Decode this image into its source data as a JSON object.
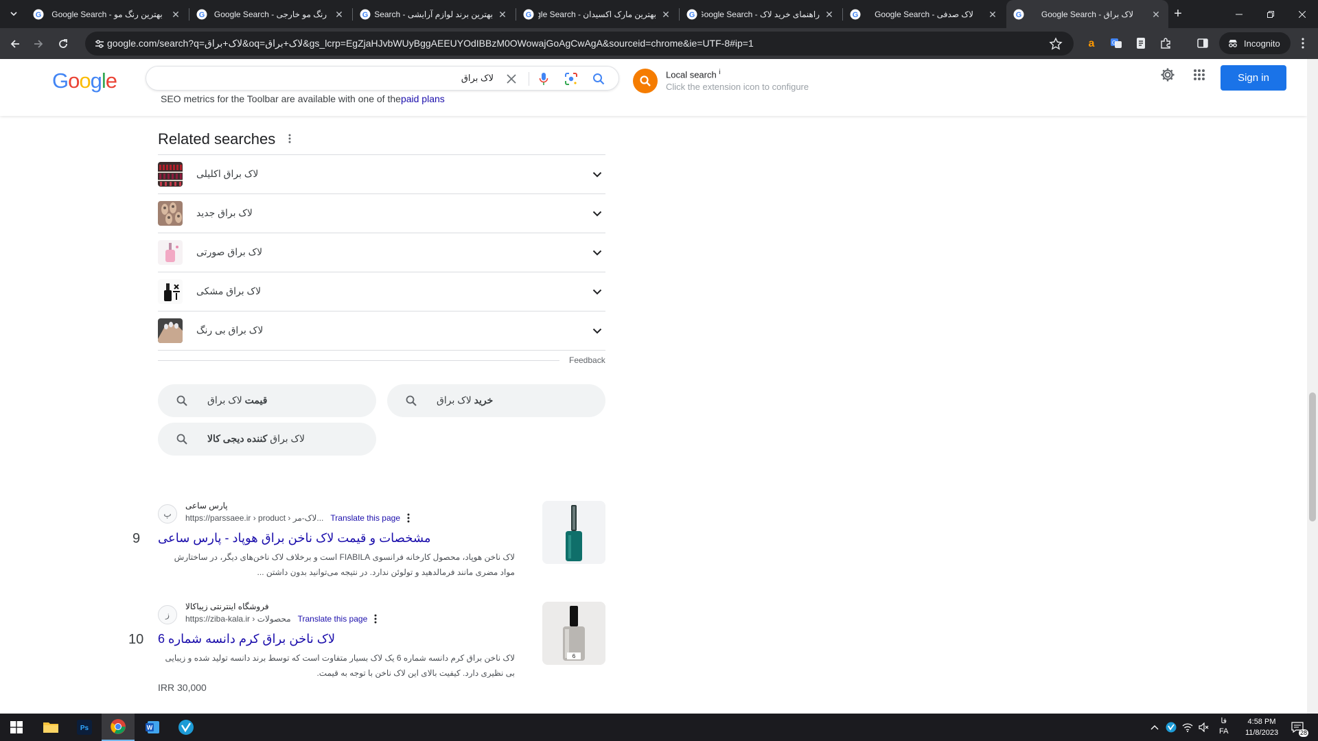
{
  "browser": {
    "tabs": [
      {
        "title": "بهترین رنگ مو - Google Search",
        "active": false
      },
      {
        "title": "رنگ مو خارجی - Google Search",
        "active": false
      },
      {
        "title": "بهترین برند لوازم آرایشی - Search",
        "active": false
      },
      {
        "title": "بهترین مارک اکسیدان - Google Search",
        "active": false
      },
      {
        "title": "راهنمای خرید لاک - Google Search",
        "active": false
      },
      {
        "title": "لاک صدفی - Google Search",
        "active": false
      },
      {
        "title": "لاک براق - Google Search",
        "active": true
      }
    ],
    "url": "google.com/search?q=لاک+براق&oq=لاک+براق&gs_lcrp=EgZjaHJvbWUyBggAEEUYOdIBBzM0OWowajGoAgCwAgA&sourceid=chrome&ie=UTF-8#ip=1",
    "incognito_label": "Incognito"
  },
  "google": {
    "logo": "Google",
    "query": "لاک براق",
    "seo_prefix": "SEO metrics for the Toolbar are available with one of the",
    "seo_link": "paid plans",
    "local_search_title": "Local search",
    "local_search_info": "i",
    "local_search_sub": "Click the extension icon to configure",
    "sign_in": "Sign in"
  },
  "related": {
    "heading": "Related searches",
    "items": [
      {
        "label": "لاک براق اکلیلی",
        "thumb": "lipstick-shelf"
      },
      {
        "label": "لاک براق جدید",
        "thumb": "nails-pattern"
      },
      {
        "label": "لاک براق صورتی",
        "thumb": "pink-bottle"
      },
      {
        "label": "لاک براق مشکی",
        "thumb": "black-bottle"
      },
      {
        "label": "لاک براق بی رنگ",
        "thumb": "hand-nails"
      }
    ],
    "feedback": "Feedback",
    "chips": [
      {
        "normal": "لاک براق",
        "bold": "قیمت"
      },
      {
        "normal": "لاک براق",
        "bold": "خرید"
      },
      {
        "normal": "لاک براق",
        "bold": "کننده دیجی کالا"
      }
    ]
  },
  "results": [
    {
      "number": "9",
      "favicon_text": "پ",
      "site_name": "پارس ساعی",
      "url": "https://parssaee.ir › product › لاک-مر...",
      "translate": "Translate this page",
      "title": "مشخصات و قیمت لاک ناخن براق هوپاد - پارس ساعی",
      "snippet": "لاک ناخن هوپاد، محصول کارخانه فرانسوی FIABILA است و برخلاف لاک ناخن‌های دیگر، در ساختارش مواد مضری مانند فرمالدهید و تولوئن ندارد. در نتیجه می‌توانید بدون داشتن ...",
      "price": ""
    },
    {
      "number": "10",
      "favicon_text": "ز",
      "site_name": "فروشگاه اینترنتی زیباکالا",
      "url": "https://ziba-kala.ir › محصولات",
      "translate": "Translate this page",
      "title": "لاک ناخن براق کرم دانسه شماره 6",
      "snippet": "لاک ناخن براق کرم دانسه شماره 6 یک لاک بسیار متفاوت است که توسط برند دانسه تولید شده و زیبایی بی نظیری دارد. کیفیت بالای این لاک ناخن با توجه به قیمت.",
      "price": "IRR 30,000"
    }
  ],
  "taskbar": {
    "lang": "فا",
    "lang_sub": "FA",
    "time": "4:58 PM",
    "date": "11/8/2023",
    "notifications": "28"
  },
  "colors": {
    "chrome_dark": "#202124",
    "chrome_toolbar": "#35363a",
    "link_blue": "#1a0dab",
    "sign_in_blue": "#1a73e8",
    "local_orange": "#f57c00"
  }
}
